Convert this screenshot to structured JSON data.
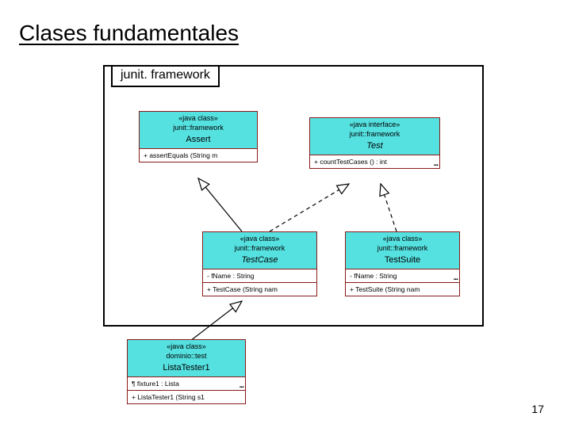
{
  "slide": {
    "title": "Clases fundamentales",
    "package_label": "junit. framework",
    "page_number": "17"
  },
  "classes": {
    "assert": {
      "stereo": "«java class»",
      "pkg": "junit::framework",
      "name": "Assert",
      "op": "+ assertEquals (String m"
    },
    "test": {
      "stereo": "«java interface»",
      "pkg": "junit::framework",
      "name": "Test",
      "op": "+ countTestCases () : int"
    },
    "testcase": {
      "stereo": "«java class»",
      "pkg": "junit::framework",
      "name": "TestCase",
      "attr": "- fName  : String",
      "op": "+ TestCase (String nam"
    },
    "testsuite": {
      "stereo": "«java class»",
      "pkg": "junit::framework",
      "name": "TestSuite",
      "attr": "- fName  : String",
      "op": "+ TestSuite (String nam"
    },
    "listatester": {
      "stereo": "«java class»",
      "pkg": "dominio::test",
      "name": "ListaTester1",
      "attr": "¶ fixture1  : Lista",
      "op": "+ ListaTester1 (String s1"
    }
  }
}
